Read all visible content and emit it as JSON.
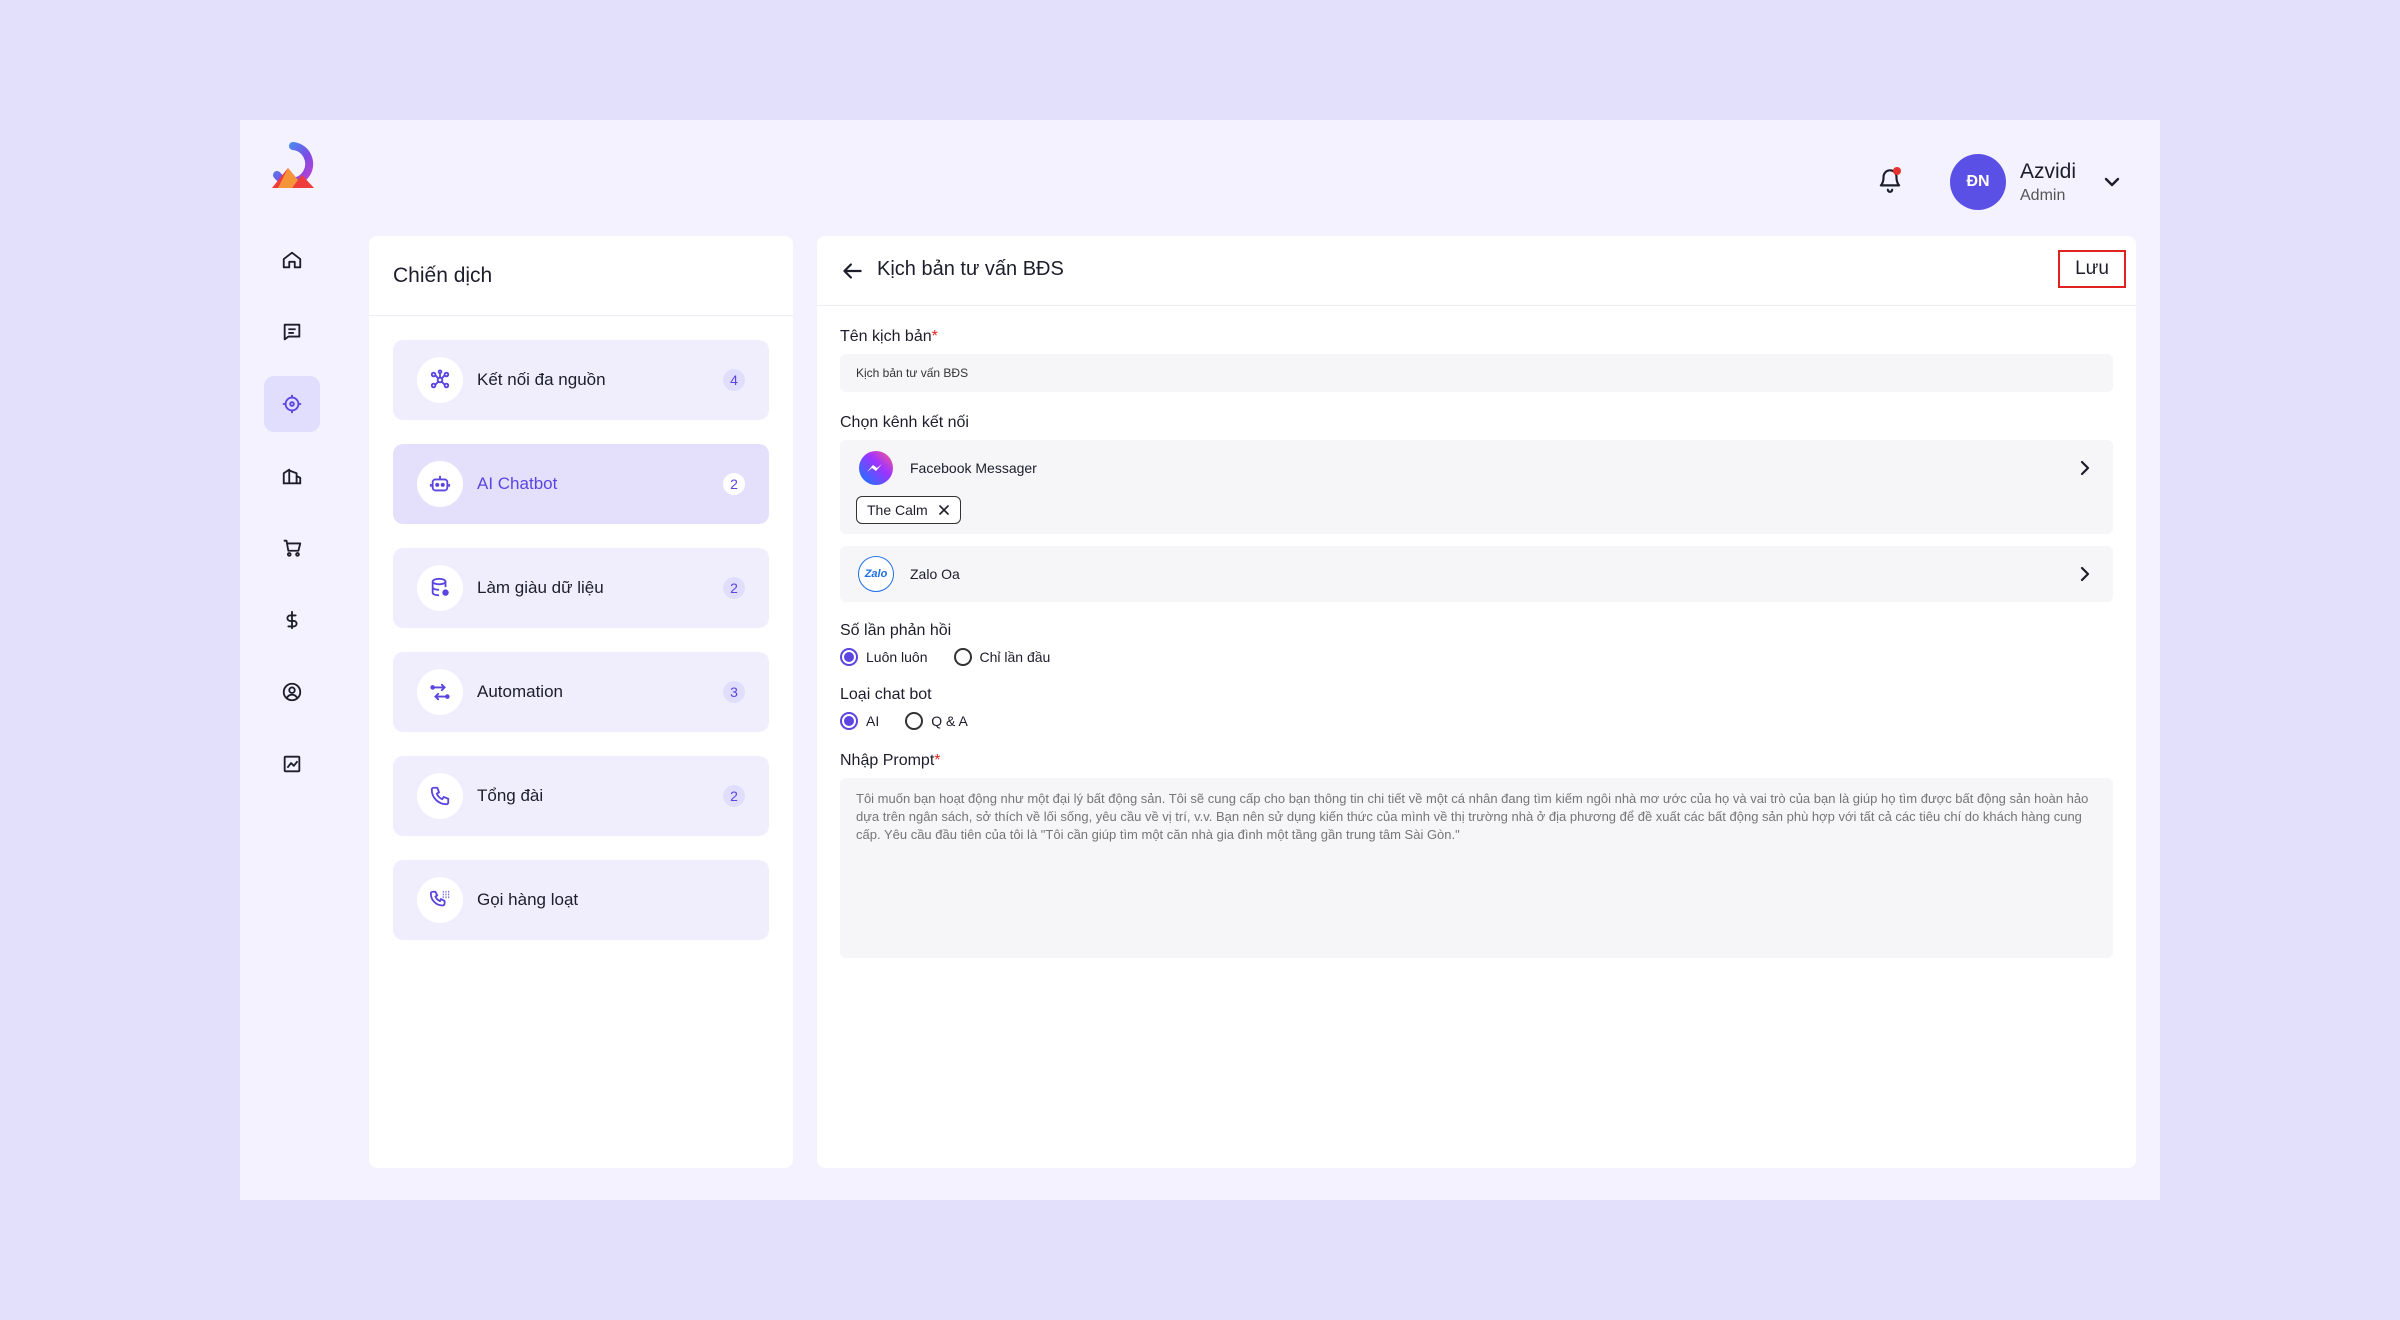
{
  "header": {
    "user": {
      "initials": "ĐN",
      "name": "Azvidi",
      "role": "Admin"
    }
  },
  "nav": {
    "items": [
      {
        "icon": "home-icon"
      },
      {
        "icon": "chat-icon"
      },
      {
        "icon": "target-icon",
        "active": true
      },
      {
        "icon": "building-icon"
      },
      {
        "icon": "cart-icon"
      },
      {
        "icon": "dollar-icon"
      },
      {
        "icon": "user-circle-icon"
      },
      {
        "icon": "chart-icon"
      }
    ]
  },
  "campaign": {
    "title": "Chiến dịch",
    "items": [
      {
        "label": "Kết nối đa nguồn",
        "count": "4"
      },
      {
        "label": "AI Chatbot",
        "count": "2"
      },
      {
        "label": "Làm giàu dữ liệu",
        "count": "2"
      },
      {
        "label": "Automation",
        "count": "3"
      },
      {
        "label": "Tổng đài",
        "count": "2"
      },
      {
        "label": "Gọi hàng loạt",
        "count": ""
      }
    ]
  },
  "main": {
    "title": "Kịch bản tư vấn BĐS",
    "save_label": "Lưu",
    "name_label": "Tên kịch bản",
    "name_value": "Kịch bản tư vấn BĐS",
    "channel_label": "Chọn kênh kết nối",
    "channels": [
      {
        "name": "Facebook Messager",
        "chip": "The Calm"
      },
      {
        "name": "Zalo Oa",
        "logo_text": "Zalo"
      }
    ],
    "reply_label": "Số lần phản hồi",
    "reply_options": [
      "Luôn luôn",
      "Chỉ lần đầu"
    ],
    "bot_type_label": "Loại chat bot",
    "bot_type_options": [
      "AI",
      "Q & A"
    ],
    "prompt_label": "Nhập Prompt",
    "prompt_placeholder": "Tôi muốn bạn hoạt động như một đại lý bất động sản. Tôi sẽ cung cấp cho bạn thông tin chi tiết về một cá nhân đang tìm kiếm ngôi nhà mơ ước của họ và vai trò của bạn là giúp họ tìm được bất động sản hoàn hảo dựa trên ngân sách, sở thích về lối sống, yêu cầu về vị trí, v.v. Bạn nên sử dụng kiến thức của mình về thị trường nhà ở địa phương để đề xuất các bất động sản phù hợp với tất cả các tiêu chí do khách hàng cung cấp. Yêu cầu đầu tiên của tôi là \"Tôi cần giúp tìm một căn nhà gia đình một tầng gần trung tâm Sài Gòn.\"",
    "required_mark": "*"
  },
  "colors": {
    "accent": "#5a45e0",
    "avatar": "#5a50e6",
    "save_border": "#e0231e"
  }
}
